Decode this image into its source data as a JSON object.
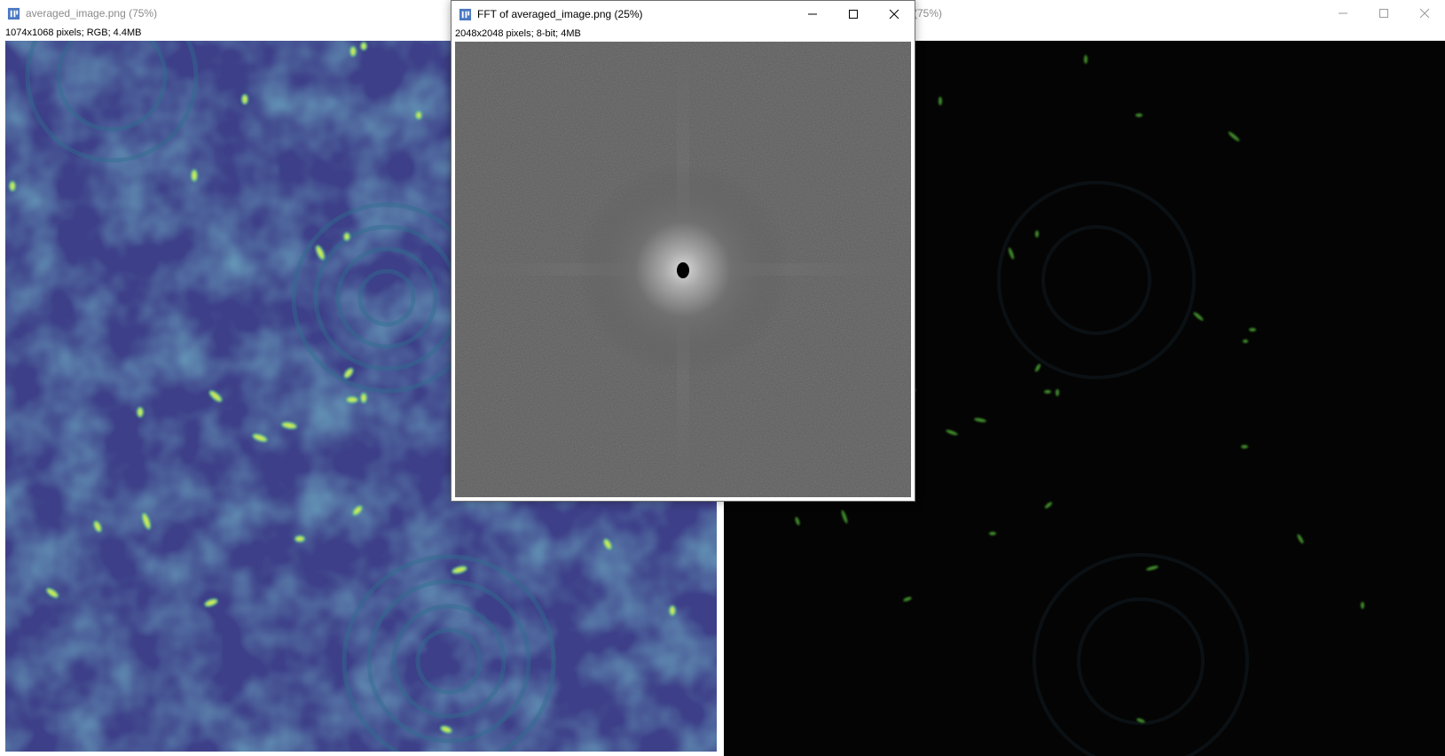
{
  "windows": {
    "left": {
      "title": "averaged_image.png (75%)",
      "info": "1074x1068 pixels; RGB; 4.4MB"
    },
    "fft": {
      "title": "FFT of averaged_image.png (25%)",
      "info": "2048x2048 pixels; 8-bit; 4MB"
    },
    "right": {
      "title": "(75%)"
    }
  },
  "icons": {
    "app": "imagej-app-icon",
    "minimize": "minimize-icon",
    "maximize": "maximize-icon",
    "close": "close-icon"
  },
  "colors": {
    "viridis_background": "#3a4a8c",
    "viridis_highlight": "#c8e64b",
    "fft_background": "#5a5a5a",
    "dark_background": "#030303",
    "spot_green": "#5fa832"
  }
}
